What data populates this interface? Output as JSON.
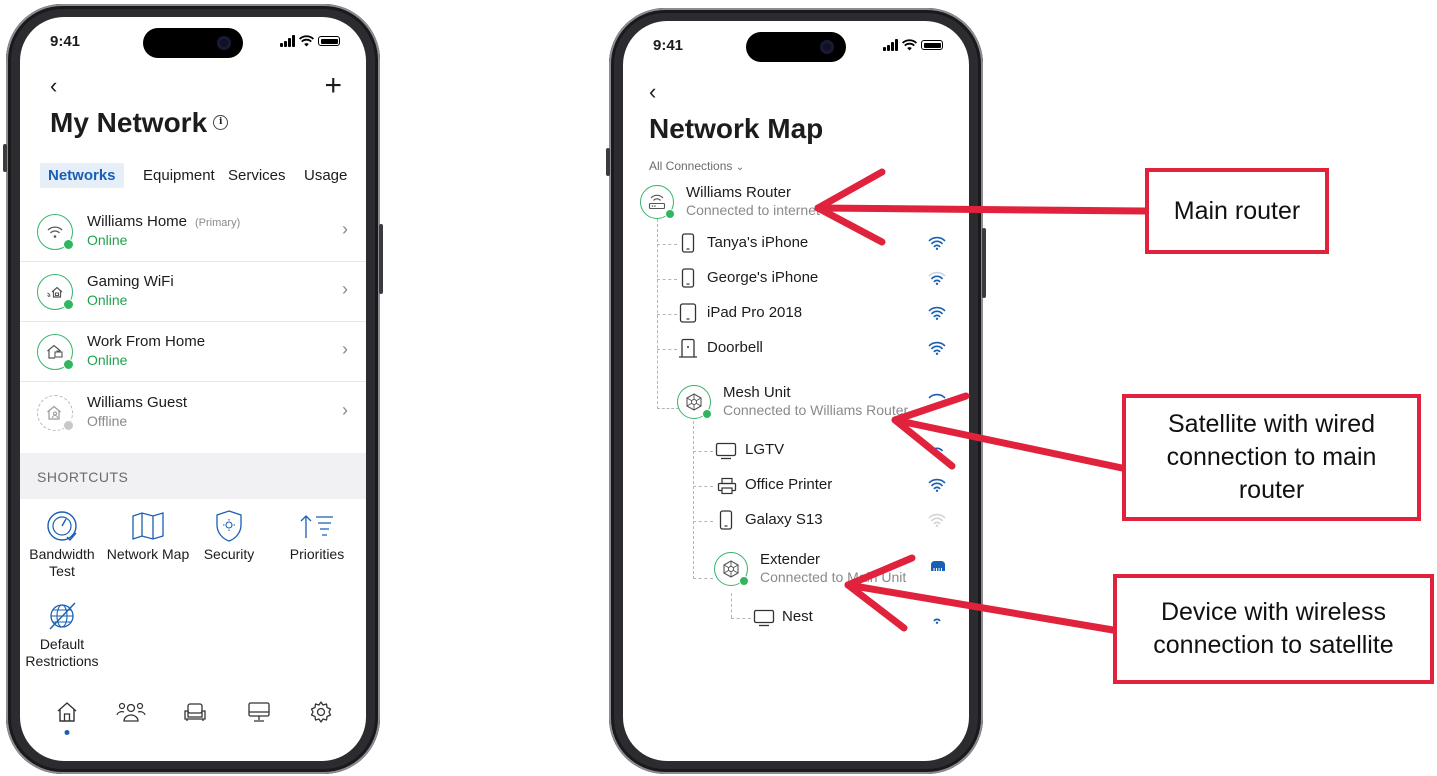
{
  "status_bar": {
    "time": "9:41"
  },
  "left_screen": {
    "title": "My Network",
    "info_icon": "info-icon",
    "back_icon": "chevron-left-icon",
    "add_icon": "plus-icon",
    "tabs": [
      {
        "label": "Networks",
        "active": true
      },
      {
        "label": "Equipment",
        "active": false
      },
      {
        "label": "Services",
        "active": false
      },
      {
        "label": "Usage",
        "active": false
      }
    ],
    "networks": [
      {
        "name": "Williams Home",
        "tag": "(Primary)",
        "status": "Online",
        "icon": "wifi-icon"
      },
      {
        "name": "Gaming WiFi",
        "tag": "",
        "status": "Online",
        "icon": "gaming-home-icon"
      },
      {
        "name": "Work From Home",
        "tag": "",
        "status": "Online",
        "icon": "work-home-icon"
      },
      {
        "name": "Williams Guest",
        "tag": "",
        "status": "Offline",
        "icon": "guest-home-icon"
      }
    ],
    "shortcuts_label": "SHORTCUTS",
    "shortcuts": [
      {
        "label": "Bandwidth Test",
        "icon": "speedometer-icon"
      },
      {
        "label": "Network Map",
        "icon": "map-icon"
      },
      {
        "label": "Security",
        "icon": "shield-icon"
      },
      {
        "label": "Priorities",
        "icon": "priorities-icon"
      },
      {
        "label": "Default Restrictions",
        "icon": "globe-restricted-icon"
      }
    ],
    "bottom_nav": [
      {
        "icon": "home-icon",
        "active": true
      },
      {
        "icon": "people-icon",
        "active": false
      },
      {
        "icon": "sofa-icon",
        "active": false
      },
      {
        "icon": "monitor-icon",
        "active": false
      },
      {
        "icon": "gear-icon",
        "active": false
      }
    ]
  },
  "right_screen": {
    "title": "Network Map",
    "filter_label": "All Connections",
    "router": {
      "name": "Williams Router",
      "subtitle": "Connected to internet"
    },
    "router_devices": [
      {
        "name": "Tanya's iPhone",
        "icon": "phone-icon",
        "signal": "strong"
      },
      {
        "name": "George's iPhone",
        "icon": "phone-icon",
        "signal": "weak"
      },
      {
        "name": "iPad Pro 2018",
        "icon": "tablet-icon",
        "signal": "strong"
      },
      {
        "name": "Doorbell",
        "icon": "doorbell-icon",
        "signal": "strong"
      }
    ],
    "mesh": {
      "name": "Mesh Unit",
      "subtitle": "Connected to Williams Router"
    },
    "mesh_devices": [
      {
        "name": "LGTV",
        "icon": "tv-icon",
        "signal": "medium"
      },
      {
        "name": "Office Printer",
        "icon": "printer-icon",
        "signal": "strong"
      },
      {
        "name": "Galaxy S13",
        "icon": "phone-icon",
        "signal": "none"
      }
    ],
    "extender": {
      "name": "Extender",
      "subtitle": "Connected to Main Unit",
      "link": "ethernet-icon"
    },
    "extender_devices": [
      {
        "name": "Nest",
        "icon": "tv-icon",
        "signal": "weak"
      }
    ]
  },
  "callouts": [
    {
      "text": "Main router"
    },
    {
      "line1": "Satellite with wired",
      "line2": "connection to main",
      "line3": "router"
    },
    {
      "line1": "Device with wireless",
      "line2": "connection to satellite"
    }
  ],
  "colors": {
    "accent_blue": "#1a5fb4",
    "online_green": "#23a24d",
    "callout_red": "#e0223c"
  }
}
